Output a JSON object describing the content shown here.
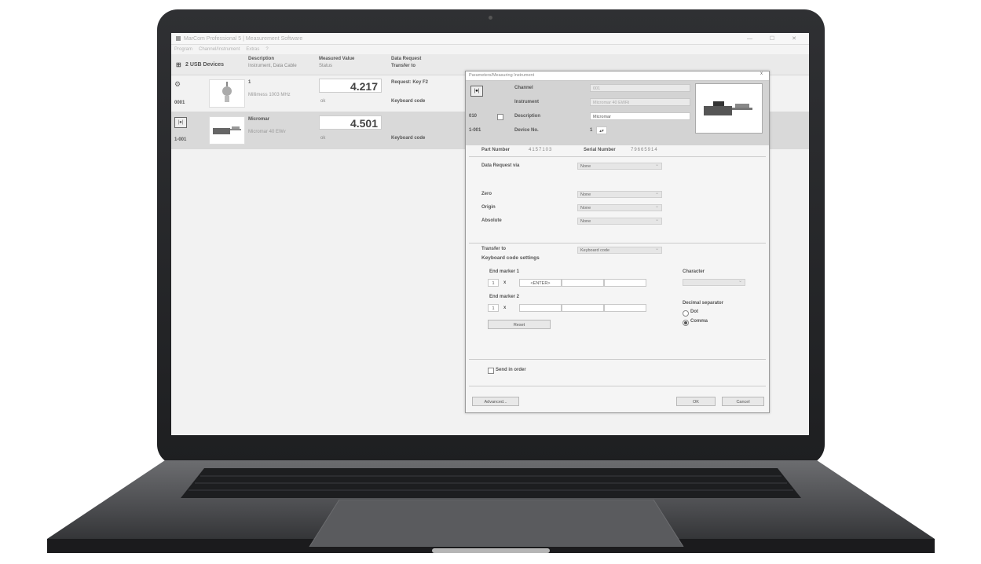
{
  "app": {
    "title": "MarCom Professional 5 | Measurement Software",
    "menu": [
      "Program",
      "Channel/Instrument",
      "Extras",
      "?"
    ]
  },
  "toolbar": {
    "usb_devices_label": "2 USB Devices"
  },
  "columns": {
    "description": "Description",
    "description_sub": "Instrument, Data Cable",
    "measured_value": "Measured Value",
    "measured_value_sub": "Status",
    "data_request": "Data Request",
    "transfer_to": "Transfer to"
  },
  "rows": [
    {
      "channel": "0001",
      "name": "1",
      "detail": "Millimess 1003 MHz",
      "value": "4.217",
      "status": "ok",
      "data_request": "Request: Key F2",
      "transfer": "Keyboard code"
    },
    {
      "channel": "1-001",
      "name": "Micromar",
      "detail": "Micromar 40 EWv",
      "value": "4.501",
      "status": "ok",
      "data_request": "",
      "transfer": "Keyboard code"
    }
  ],
  "dialog": {
    "title": "Parameters/Measuring Instrument",
    "close_icon": "x",
    "channel_label": "Channel",
    "channel_value": "001",
    "instrument_label": "Instrument",
    "instrument_value": "Micromar 40 EWRi",
    "description_label": "Description",
    "description_value": "Micromar",
    "device_no_label": "Device No.",
    "device_no_value": "1",
    "device_no_prefix": "1-001",
    "left_code": "010",
    "part_number_label": "Part Number",
    "part_number_value": "4157103",
    "serial_number_label": "Serial Number",
    "serial_number_value": "79665914",
    "data_request_label": "Data Request via",
    "data_request_value": "None",
    "zero_label": "Zero",
    "zero_value": "None",
    "origin_label": "Origin",
    "origin_value": "None",
    "absolute_label": "Absolute",
    "absolute_value": "None",
    "transfer_to_label": "Transfer to",
    "transfer_to_value": "Keyboard code",
    "keyboard_settings_label": "Keyboard code settings",
    "end_marker1_label": "End marker 1",
    "end_marker1_count": "1",
    "end_marker1_x": "x",
    "end_marker1_key": "<ENTER>",
    "end_marker2_label": "End marker 2",
    "end_marker2_count": "1",
    "end_marker2_x": "x",
    "reset_label": "Reset",
    "character_label": "Character",
    "decimal_sep_label": "Decimal separator",
    "dot_label": "Dot",
    "comma_label": "Comma",
    "decimal_sep_selected": "Comma",
    "send_in_order_label": "Send in order",
    "advanced_button": "Advanced...",
    "ok_button": "OK",
    "cancel_button": "Cancel"
  }
}
